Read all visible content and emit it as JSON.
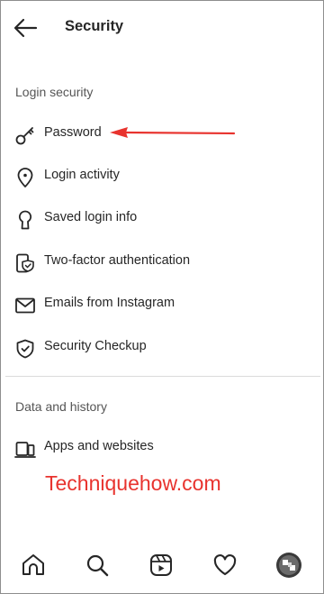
{
  "header": {
    "title": "Security"
  },
  "sections": [
    {
      "label": "Login security",
      "items": [
        {
          "label": "Password",
          "icon": "key-icon"
        },
        {
          "label": "Login activity",
          "icon": "location-pin-icon"
        },
        {
          "label": "Saved login info",
          "icon": "keyhole-icon"
        },
        {
          "label": "Two-factor authentication",
          "icon": "shield-phone-icon"
        },
        {
          "label": "Emails from Instagram",
          "icon": "mail-icon"
        },
        {
          "label": "Security Checkup",
          "icon": "shield-check-icon"
        }
      ]
    },
    {
      "label": "Data and history",
      "items": [
        {
          "label": "Apps and websites",
          "icon": "devices-icon"
        }
      ]
    }
  ],
  "watermark": "Techniquehow.com",
  "annotation": {
    "color": "#e8332e"
  },
  "tabs": [
    "home-icon",
    "search-icon",
    "reels-icon",
    "heart-icon",
    "profile-avatar"
  ]
}
